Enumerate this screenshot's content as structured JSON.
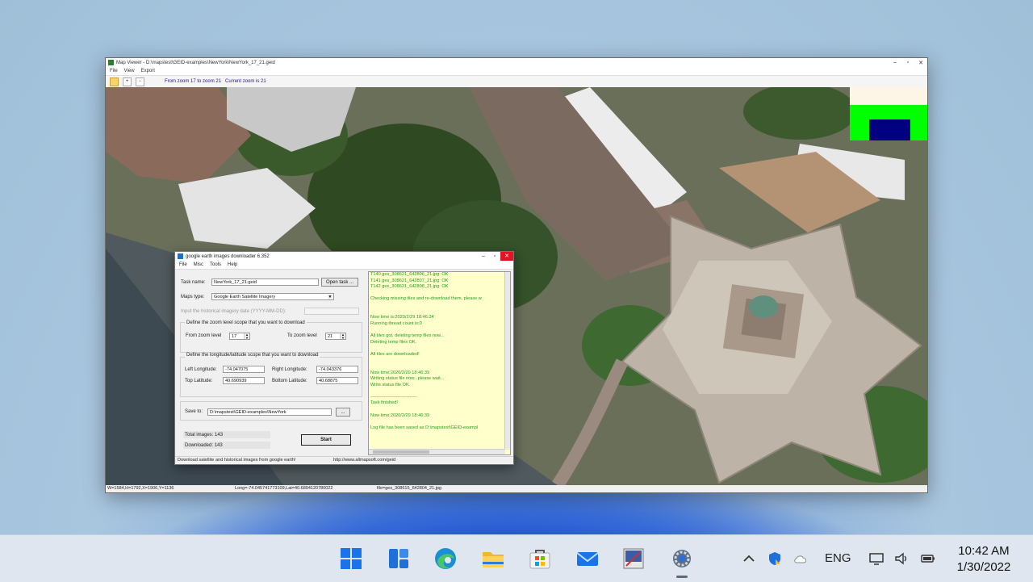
{
  "map_viewer": {
    "title": "Map Viewer - D:\\mapstest\\GEID-examples\\NewYork\\NewYork_17_21.geid",
    "menu": [
      "File",
      "View",
      "Export"
    ],
    "toolbar": {
      "zoom_range": "From zoom 17 to zoom 21",
      "current_zoom": "Current zoom is 21"
    },
    "status": {
      "tile": "W=1584,H=1792,X=1906,Y=1136",
      "coords": "Long=-74.045741773109,Lat=40.6894120780022",
      "file": "file=ges_308615_642804_21.jpg"
    }
  },
  "downloader": {
    "title": "google earth images downloader 6.352",
    "menu": [
      "File",
      "Misc",
      "Tools",
      "Help"
    ],
    "task_name_label": "Task name:",
    "task_name_value": "NewYork_17_21.geid",
    "open_task_label": "Open task ...",
    "maps_type_label": "Maps type:",
    "maps_type_value": "Google Earth Satellite Imagery",
    "historical_label": "Input the  historical imagery date (YYYY-MM-DD):",
    "zoom_group_label": "Define the zoom level scope that you want to download",
    "from_zoom_label": "From zoom level",
    "from_zoom_value": "17",
    "to_zoom_label": "To zoom level",
    "to_zoom_value": "21",
    "lonlat_group_label": "Define the longitude/latitude scope that you want to download",
    "left_lon_label": "Left Longitude:",
    "left_lon_value": "-74.047075",
    "right_lon_label": "Right Longitude:",
    "right_lon_value": "-74.043376",
    "top_lat_label": "Top Latitude:",
    "top_lat_value": "40.690939",
    "bottom_lat_label": "Bottom Latitude:",
    "bottom_lat_value": "40.68875",
    "save_to_label": "Save to:",
    "save_to_value": "D:\\mapstest\\GEID-examples\\NewYork",
    "browse_label": "...",
    "total_images": "Total images: 143",
    "downloaded": "Downloaded: 143",
    "start_label": "Start",
    "status_left": "Download satellite and historical images from google earth!",
    "status_url": "http://www.allmapsoft.com/geid",
    "log": [
      "T140 ges_308621_642806_21.jpg:  OK",
      "T141 ges_308621_642807_21.jpg:  OK",
      "T142 ges_308621_642808_21.jpg:  OK",
      "",
      "Checking missing tiles and re-download them, please w",
      "",
      "",
      "Now time is:2020/2/29 18:46:34",
      "Running thread count is:0",
      "",
      "All tiles got, deleting temp files now...",
      "Deleting temp files OK.",
      "",
      "All tiles are downloaded!",
      "",
      "",
      "Now time:2020/2/29 18:46:39",
      "Writing status file now...please wait...",
      "Write status file OK.",
      "",
      "-------------------------------",
      "Task finished!",
      "",
      "Now time:2020/2/29 18:46:39",
      "",
      "Log file has been saved as D:\\mapstest\\GEID-exampl"
    ]
  },
  "taskbar": {
    "apps": [
      "start-icon",
      "widgets-icon",
      "edge-icon",
      "file-explorer-icon",
      "store-icon",
      "mail-icon",
      "app-icon",
      "settings-icon"
    ],
    "language": "ENG",
    "time": "10:42 AM",
    "date": "1/30/2022"
  }
}
